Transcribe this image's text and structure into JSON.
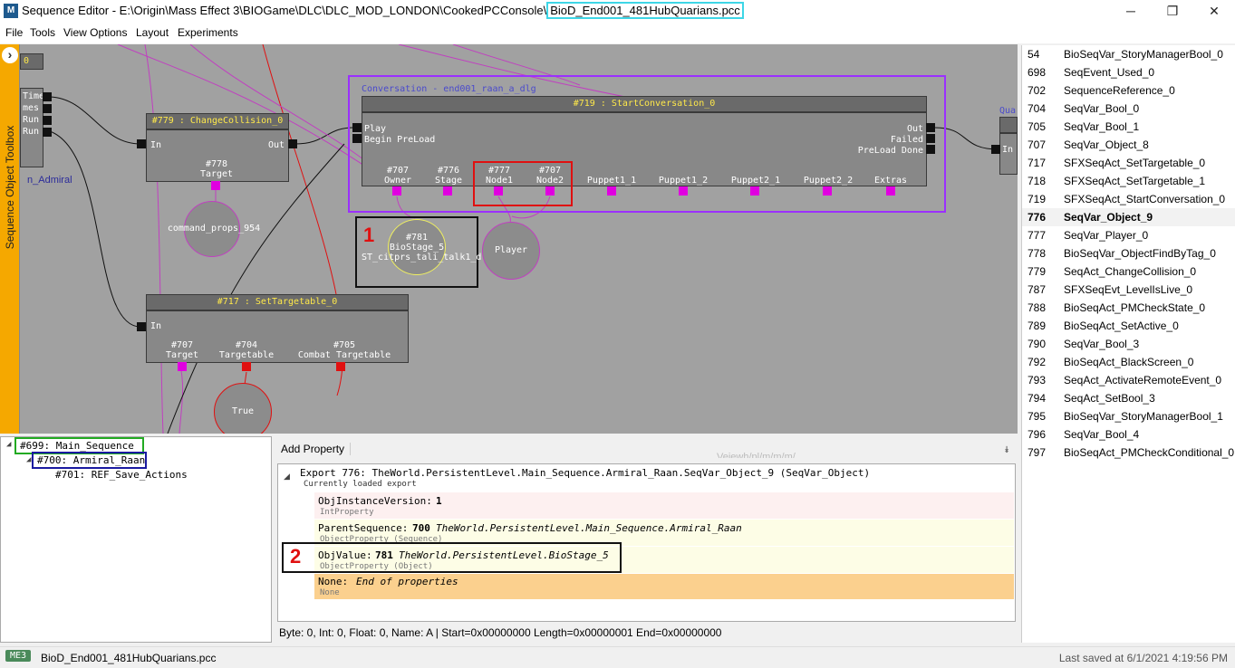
{
  "window": {
    "title_prefix": "Sequence Editor - E:\\Origin\\Mass Effect 3\\BIOGame\\DLC\\DLC_MOD_LONDON\\CookedPCConsole\\",
    "title_file": "BioD_End001_481HubQuarians.pcc",
    "app_icon": "M",
    "minimize": "─",
    "restore": "❐",
    "close": "✕"
  },
  "menu": [
    "File",
    "Tools",
    "View Options",
    "Layout",
    "Experiments"
  ],
  "toolbox": {
    "label": "Sequence Object Toolbox",
    "arrow": "›"
  },
  "graph": {
    "left_node": {
      "lines": [
        "Time",
        "mes",
        "Run",
        "Run"
      ],
      "top_label": "0",
      "admiral_label": "n_Admiral"
    },
    "change_collision": {
      "title": "#779 : ChangeCollision_0",
      "in": "In",
      "out": "Out",
      "var_idx": "#778",
      "var_name": "Target"
    },
    "command_props": "command_props_954",
    "set_targetable": {
      "title": "#717 : SetTargetable_0",
      "in": "In",
      "vars": [
        [
          "#707",
          "Target"
        ],
        [
          "#704",
          "Targetable"
        ],
        [
          "#705",
          "Combat Targetable"
        ]
      ]
    },
    "true_var": "True",
    "conversation_group": "Conversation - end001_raan_a_dlg",
    "start_conversation": {
      "title": "#719 : StartConversation_0",
      "inputs": [
        "Play",
        "Begin PreLoad"
      ],
      "outputs": [
        "Out",
        "Failed",
        "PreLoad Done"
      ],
      "vars": [
        [
          "#707",
          "Owner"
        ],
        [
          "#776",
          "Stage"
        ],
        [
          "#777",
          "Node1"
        ],
        [
          "#707",
          "Node2"
        ],
        [
          "",
          "Puppet1_1"
        ],
        [
          "",
          "Puppet1_2"
        ],
        [
          "",
          "Puppet2_1"
        ],
        [
          "",
          "Puppet2_2"
        ],
        [
          "",
          "Extras"
        ]
      ]
    },
    "biostage": {
      "idx": "#781",
      "name": "BioStage_5",
      "sub": "ST_citprs_tali_talk1_d"
    },
    "player": "Player",
    "right_node": {
      "label": "Qua",
      "in": "In"
    },
    "annotation_1": "1",
    "annotation_2": "2"
  },
  "tree": {
    "root": "#699: Main_Sequence",
    "child": "#700: Armiral_Raan",
    "grandchild": "#701: REF_Save_Actions"
  },
  "props": {
    "add_property": "Add Property",
    "faded_text": "Veiewh/pl/m/m/m/",
    "export_header": "Export 776: TheWorld.PersistentLevel.Main_Sequence.Armiral_Raan.SeqVar_Object_9 (SeqVar_Object)",
    "export_sub": "Currently loaded export",
    "rows": [
      {
        "name": "ObjInstanceVersion:",
        "value": "1",
        "path": "",
        "type": "IntProperty"
      },
      {
        "name": "ParentSequence:",
        "value": "700",
        "path": "TheWorld.PersistentLevel.Main_Sequence.Armiral_Raan",
        "type": "ObjectProperty (Sequence)"
      },
      {
        "name": "ObjValue:",
        "value": "781",
        "path": "TheWorld.PersistentLevel.BioStage_5",
        "type": "ObjectProperty (Object)"
      },
      {
        "name": "None:",
        "value": "",
        "path": "End of properties",
        "type": "None"
      }
    ],
    "status": "Byte: 0, Int: 0, Float: 0, Name: A | Start=0x00000000 Length=0x00000001 End=0x00000000"
  },
  "exports": [
    [
      "54",
      "BioSeqVar_StoryManagerBool_0"
    ],
    [
      "698",
      "SeqEvent_Used_0"
    ],
    [
      "702",
      "SequenceReference_0"
    ],
    [
      "704",
      "SeqVar_Bool_0"
    ],
    [
      "705",
      "SeqVar_Bool_1"
    ],
    [
      "707",
      "SeqVar_Object_8"
    ],
    [
      "717",
      "SFXSeqAct_SetTargetable_0"
    ],
    [
      "718",
      "SFXSeqAct_SetTargetable_1"
    ],
    [
      "719",
      "SFXSeqAct_StartConversation_0"
    ],
    [
      "776",
      "SeqVar_Object_9"
    ],
    [
      "777",
      "SeqVar_Player_0"
    ],
    [
      "778",
      "BioSeqVar_ObjectFindByTag_0"
    ],
    [
      "779",
      "SeqAct_ChangeCollision_0"
    ],
    [
      "787",
      "SFXSeqEvt_LevelIsLive_0"
    ],
    [
      "788",
      "BioSeqAct_PMCheckState_0"
    ],
    [
      "789",
      "BioSeqAct_SetActive_0"
    ],
    [
      "790",
      "SeqVar_Bool_3"
    ],
    [
      "792",
      "BioSeqAct_BlackScreen_0"
    ],
    [
      "793",
      "SeqAct_ActivateRemoteEvent_0"
    ],
    [
      "794",
      "SeqAct_SetBool_3"
    ],
    [
      "795",
      "BioSeqVar_StoryManagerBool_1"
    ],
    [
      "796",
      "SeqVar_Bool_4"
    ],
    [
      "797",
      "BioSeqAct_PMCheckConditional_0"
    ]
  ],
  "selected_export_index": 9,
  "statusbar": {
    "badge": "ME3",
    "file": "BioD_End001_481HubQuarians.pcc",
    "saved": "Last saved at 6/1/2021 4:19:56 PM"
  },
  "colors": {
    "graph_bg": "#a1a1a1",
    "toolbox": "#f5a800",
    "title_file_border": "#3ed6e6",
    "conversation_border": "#9b30ff",
    "node_title_text": "#ffe94a",
    "tree_root_border": "#22aa22",
    "tree_child_border": "#1a1aa0",
    "annotation_red": "#e01010"
  }
}
